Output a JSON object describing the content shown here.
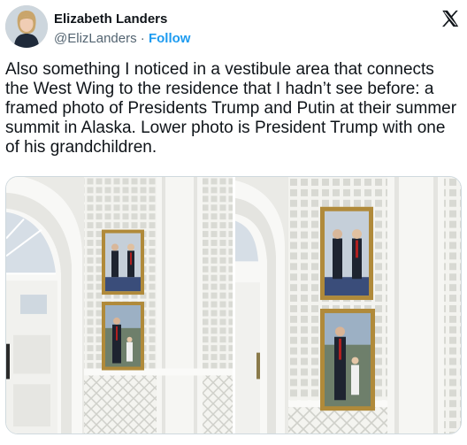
{
  "author": {
    "name": "Elizabeth Landers",
    "handle": "@ElizLanders",
    "separator": "·",
    "follow_label": "Follow"
  },
  "tweet": {
    "text": "Also something I noticed in a vestibule area that connects the West Wing to the residence that I hadn’t see before: a framed photo of Presidents Trump and Putin at their summer summit in Alaska. Lower photo is President Trump with one of his grandchildren."
  },
  "icons": {
    "platform_logo": "x-logo-icon"
  },
  "colors": {
    "link": "#1d9bf0",
    "secondary_text": "#536471",
    "primary_text": "#0f1419",
    "border": "#cfd9de"
  }
}
